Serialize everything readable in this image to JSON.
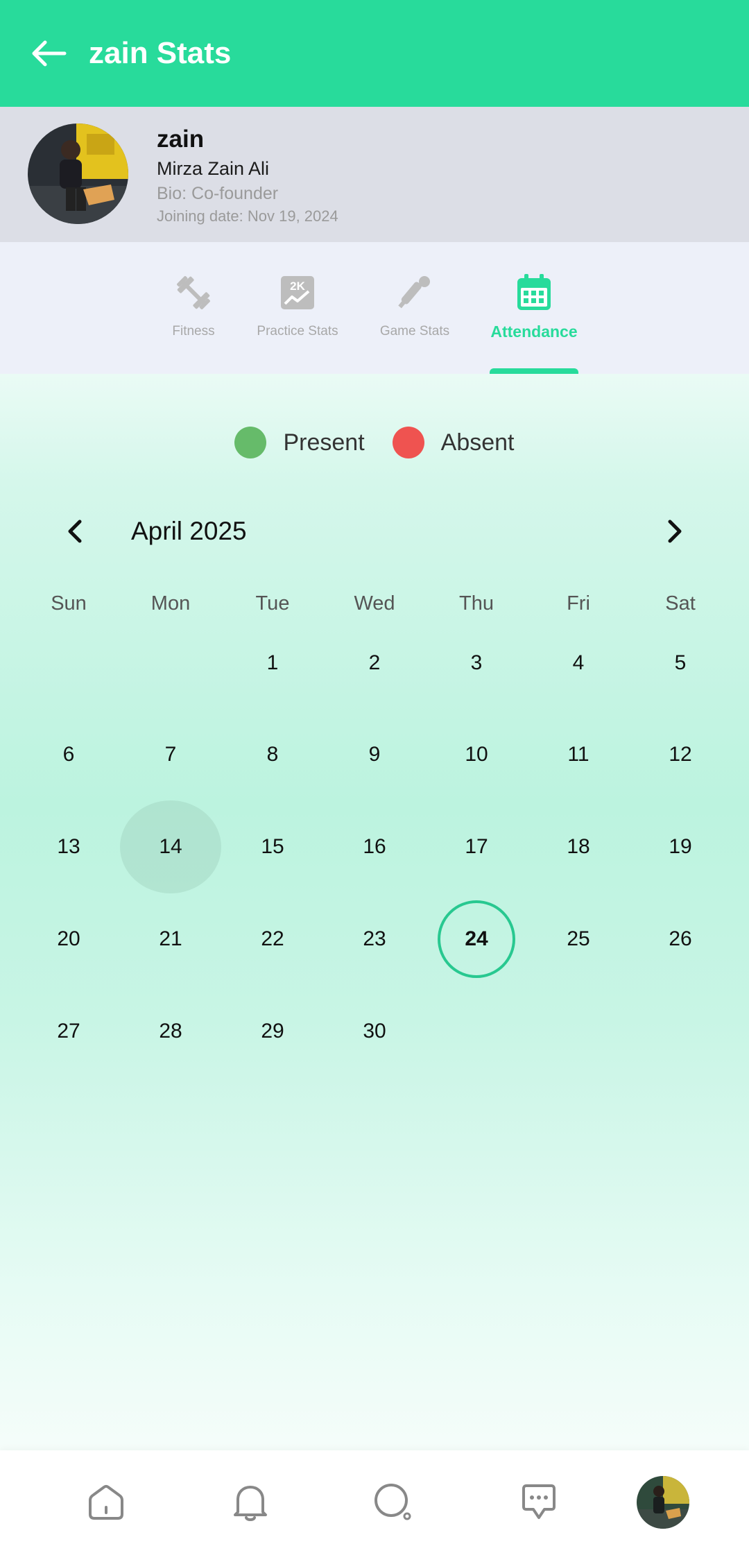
{
  "header": {
    "title": "zain Stats"
  },
  "profile": {
    "username": "zain",
    "full_name": "Mirza Zain Ali",
    "bio": "Bio: Co-founder",
    "joining_date": "Joining date: Nov 19, 2024"
  },
  "tabs": [
    {
      "label": "Fitness",
      "icon": "dumbbell-icon",
      "active": false
    },
    {
      "label": "Practice Stats",
      "icon": "2k-chart-icon",
      "active": false
    },
    {
      "label": "Game Stats",
      "icon": "cricket-bat-ball-icon",
      "active": false
    },
    {
      "label": "Attendance",
      "icon": "calendar-icon",
      "active": true
    }
  ],
  "legend": [
    {
      "label": "Present",
      "color": "#66BB6A"
    },
    {
      "label": "Absent",
      "color": "#EF5350"
    }
  ],
  "calendar": {
    "month_title": "April 2025",
    "weekdays": [
      "Sun",
      "Mon",
      "Tue",
      "Wed",
      "Thu",
      "Fri",
      "Sat"
    ],
    "first_weekday_index": 2,
    "day_count": 30,
    "selected_day": 14,
    "today": 24
  },
  "bottom_nav": [
    {
      "icon": "home-icon"
    },
    {
      "icon": "bell-icon"
    },
    {
      "icon": "search-icon"
    },
    {
      "icon": "chat-icon"
    },
    {
      "icon": "profile-avatar"
    }
  ],
  "colors": {
    "accent": "#28DB9B",
    "profile_bg": "#DCDEE6",
    "tabs_bg": "#EDF0F9",
    "inactive_icon": "#BDBDBD"
  }
}
